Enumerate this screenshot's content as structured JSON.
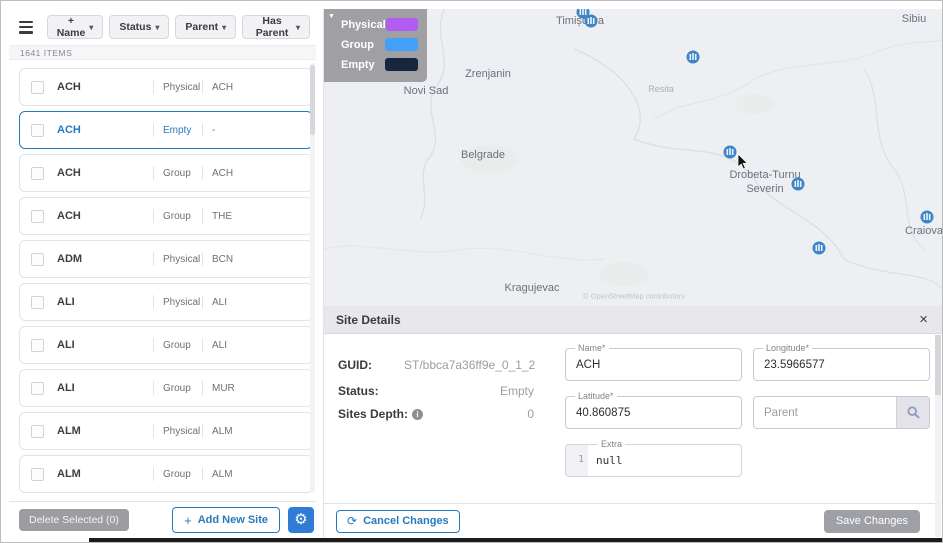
{
  "icons": {
    "caret": "▾",
    "plus": "+",
    "gear": "⚙",
    "close": "×",
    "cancel": "⟳",
    "info": "i",
    "legend_collapse": "▼"
  },
  "sidebar": {
    "filters": [
      "+ Name",
      "Status",
      "Parent",
      "Has Parent"
    ],
    "items_count": "1641 ITEMS",
    "rows": [
      {
        "name": "ACH",
        "status": "Physical",
        "parent": "ACH"
      },
      {
        "name": "ACH",
        "status": "Empty",
        "parent": "-"
      },
      {
        "name": "ACH",
        "status": "Group",
        "parent": "ACH"
      },
      {
        "name": "ACH",
        "status": "Group",
        "parent": "THE"
      },
      {
        "name": "ADM",
        "status": "Physical",
        "parent": "BCN"
      },
      {
        "name": "ALI",
        "status": "Physical",
        "parent": "ALI"
      },
      {
        "name": "ALI",
        "status": "Group",
        "parent": "ALI"
      },
      {
        "name": "ALI",
        "status": "Group",
        "parent": "MUR"
      },
      {
        "name": "ALM",
        "status": "Physical",
        "parent": "ALM"
      },
      {
        "name": "ALM",
        "status": "Group",
        "parent": "ALM"
      }
    ],
    "selected_row_index": 1,
    "selected_color": "#2779bd",
    "delete_button": "Delete Selected (0)",
    "add_button": "Add New Site"
  },
  "map": {
    "legend": {
      "items": [
        {
          "label": "Physical",
          "color": "#b35cf0"
        },
        {
          "label": "Group",
          "color": "#42a0f7"
        },
        {
          "label": "Empty",
          "color": "#16263f"
        }
      ]
    },
    "labels": [
      {
        "text": "Timișoara"
      },
      {
        "text": "Sibiu"
      },
      {
        "text": "Zrenjanin"
      },
      {
        "text": "Novi Sad"
      },
      {
        "text": "Resita"
      },
      {
        "text": "Belgrade"
      },
      {
        "text": "Drobeta-Turnu Severin"
      },
      {
        "text": "Craiova"
      },
      {
        "text": "Kragujevac"
      }
    ],
    "marker_color": "#3d85c6",
    "attribution": "© OpenStreetMap contributors"
  },
  "details": {
    "title": "Site Details",
    "guid_label": "GUID:",
    "guid_value": "ST/bbca7a36ff9e_0_1_2",
    "status_label": "Status:",
    "status_value": "Empty",
    "depth_label": "Sites Depth:",
    "depth_value": "0",
    "name_label": "Name*",
    "name_value": "ACH",
    "longitude_label": "Longitude*",
    "longitude_value": "23.5966577",
    "latitude_label": "Latitude*",
    "latitude_value": "40.860875",
    "parent_placeholder": "Parent",
    "extra_label": "Extra",
    "extra_line": "1",
    "extra_value": "null",
    "cancel_button": "Cancel Changes",
    "save_button": "Save Changes"
  }
}
